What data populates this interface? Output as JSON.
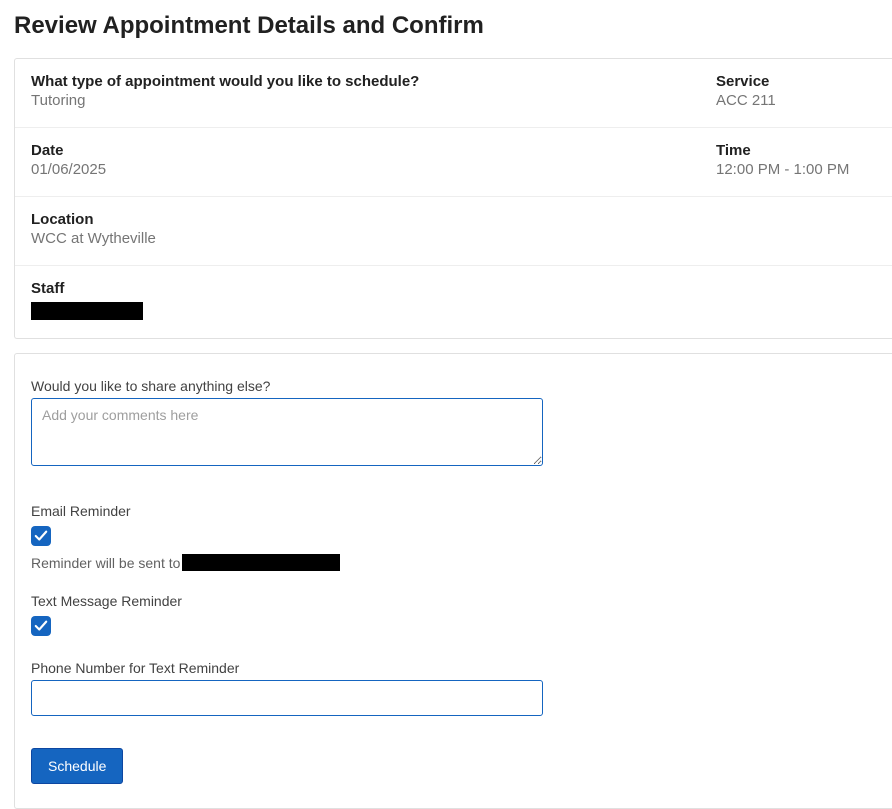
{
  "page_title": "Review Appointment Details and Confirm",
  "details": {
    "type_label": "What type of appointment would you like to schedule?",
    "type_value": "Tutoring",
    "service_label": "Service",
    "service_value": "ACC 211",
    "date_label": "Date",
    "date_value": "01/06/2025",
    "time_label": "Time",
    "time_value": "12:00 PM - 1:00 PM",
    "location_label": "Location",
    "location_value": "WCC at Wytheville",
    "staff_label": "Staff"
  },
  "form": {
    "comments_label": "Would you like to share anything else?",
    "comments_placeholder": "Add your comments here",
    "comments_value": "",
    "email_reminder_label": "Email Reminder",
    "email_reminder_checked": true,
    "email_reminder_hint_prefix": "Reminder will be sent to",
    "text_reminder_label": "Text Message Reminder",
    "text_reminder_checked": true,
    "phone_label": "Phone Number for Text Reminder",
    "phone_value": "",
    "schedule_button": "Schedule"
  }
}
